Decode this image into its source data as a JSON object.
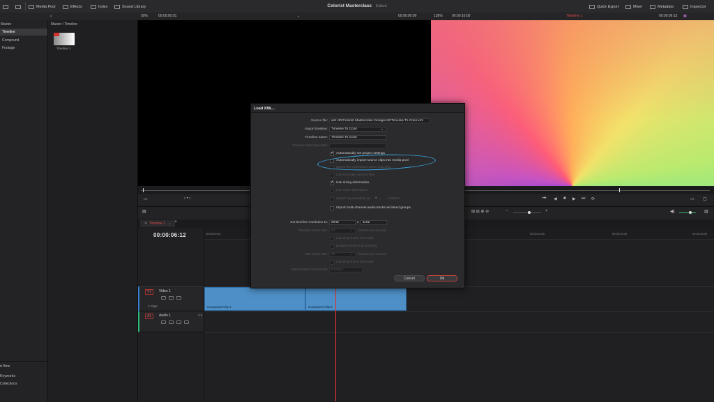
{
  "app": {
    "title": "Colorist Masterclass",
    "status": "Edited"
  },
  "topbar": {
    "left_items": [
      "Media Pool",
      "Effects",
      "Index",
      "Sound Library"
    ],
    "right_items": [
      "Quick Export",
      "Mixer",
      "Metadata",
      "Inspector"
    ]
  },
  "bar2": {
    "zoom_left": "50%",
    "tc_left": "00:00:00:01",
    "tc_mid": "00:00:00:00",
    "zoom_right": "138%",
    "tc_right_a": "00:00:10:00",
    "timeline_name": "Timeline 1",
    "tc_right_b": "00:00:06:12"
  },
  "sidebar": {
    "header": "Master",
    "items": [
      "Timeline",
      "Compound",
      "Footage"
    ],
    "bins_header": "rt Bins",
    "bins": [
      "Keywords",
      "Collections"
    ]
  },
  "media_pool": {
    "path": "Master / Timeline",
    "thumb_label": "Timeline 1"
  },
  "timeline": {
    "tab": "Timeline 1",
    "timecode": "00:00:06:12",
    "ruler": [
      "00:00:00:00",
      "00:00:10:00",
      "00:00:20:00",
      "00:00:24:00"
    ],
    "v1": {
      "badge": "V1",
      "name": "Video 1",
      "clips_count": "2 Clips"
    },
    "a1": {
      "badge": "A1",
      "name": "Audio 1",
      "level": "2.0"
    },
    "clips": [
      "Compound Clip 1",
      "Compound Clip 2"
    ]
  },
  "dialog": {
    "title": "Load XML...",
    "source_file_label": "Source file:",
    "source_file_value": "ard HD/Colorist Masterclass footage/AE/Timeline To Color.xml",
    "import_timeline_label": "Import timeline:",
    "import_timeline_value": "Timeline To Color",
    "timeline_name_label": "Timeline name:",
    "timeline_name_value": "Timeline To Color",
    "start_tc_label": "Timeline start timecode:",
    "opt_auto_project": "Automatically set project settings",
    "opt_auto_import": "Automatically import source clips into media pool",
    "opt_ignore_ext": "Ignore file extensions when matching",
    "opt_camera_files": "Use to locate camera files",
    "opt_sizing": "Use sizing information",
    "opt_color": "Use color information",
    "opt_tag": "Import tag metadata as",
    "opt_tag_suffix": "markers",
    "opt_multichannel": "Import multi-channel audio tracks as linked groups",
    "res_label": "Set timeline resolution to:",
    "res_w": "2048",
    "res_x": "x",
    "res_h": "1152",
    "fps_label": "Timeline frame rate:",
    "fps_value": "24",
    "fps_suffix": "frames per second",
    "drop_frame": "Use drop frame timecode",
    "interlace": "Enable interlace processing",
    "sdi_label": "SDI frame rate:",
    "sdi_value": "25",
    "sdi_suffix": "frames per second",
    "sdi_drop": "Use drop frame timecode",
    "mixed_label": "Mixed frame rate format:",
    "mixed_value": "Resolve",
    "cancel": "Cancel",
    "ok": "Ok"
  },
  "colors": {
    "accent_red": "#d4302c",
    "annotation_blue": "#3aa6e0",
    "clip_blue": "#4d8fc6"
  }
}
